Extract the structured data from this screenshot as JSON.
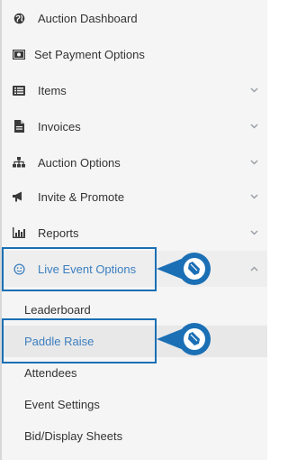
{
  "sidebar": {
    "items": [
      {
        "label": "Auction Dashboard",
        "icon": "globe-icon",
        "has_chevron": false
      },
      {
        "label": "Set Payment Options",
        "icon": "money-icon",
        "has_chevron": false
      },
      {
        "label": "Items",
        "icon": "list-icon",
        "has_chevron": true
      },
      {
        "label": "Invoices",
        "icon": "document-icon",
        "has_chevron": true
      },
      {
        "label": "Auction Options",
        "icon": "sitemap-icon",
        "has_chevron": true
      },
      {
        "label": "Invite & Promote",
        "icon": "megaphone-icon",
        "has_chevron": true
      },
      {
        "label": "Reports",
        "icon": "bar-chart-icon",
        "has_chevron": true
      },
      {
        "label": "Live Event Options",
        "icon": "smiley-icon",
        "has_chevron": true,
        "expanded": true
      }
    ],
    "sub_items": [
      {
        "label": "Leaderboard"
      },
      {
        "label": "Paddle Raise",
        "selected": true
      },
      {
        "label": "Attendees"
      },
      {
        "label": "Event Settings"
      },
      {
        "label": "Bid/Display Sheets"
      }
    ]
  },
  "colors": {
    "accent": "#3b7fc0",
    "callout": "#1a6fb5",
    "text": "#333333",
    "sidebar_bg": "#f5f5f5"
  }
}
